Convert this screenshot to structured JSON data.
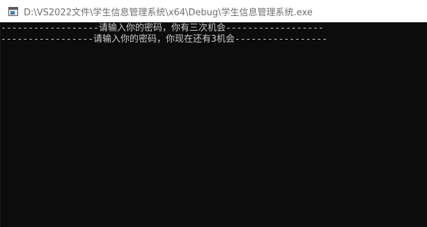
{
  "window": {
    "title": "D:\\VS2022文件\\学生信息管理系统\\x64\\Debug\\学生信息管理系统.exe",
    "icon": "console-app-icon"
  },
  "console": {
    "lines": [
      "------------------请输入你的密码，你有三次机会------------------",
      "-----------------请输入你的密码，你现在还有3机会-----------------"
    ],
    "background": "#0c0c0c",
    "foreground": "#cccccc"
  }
}
